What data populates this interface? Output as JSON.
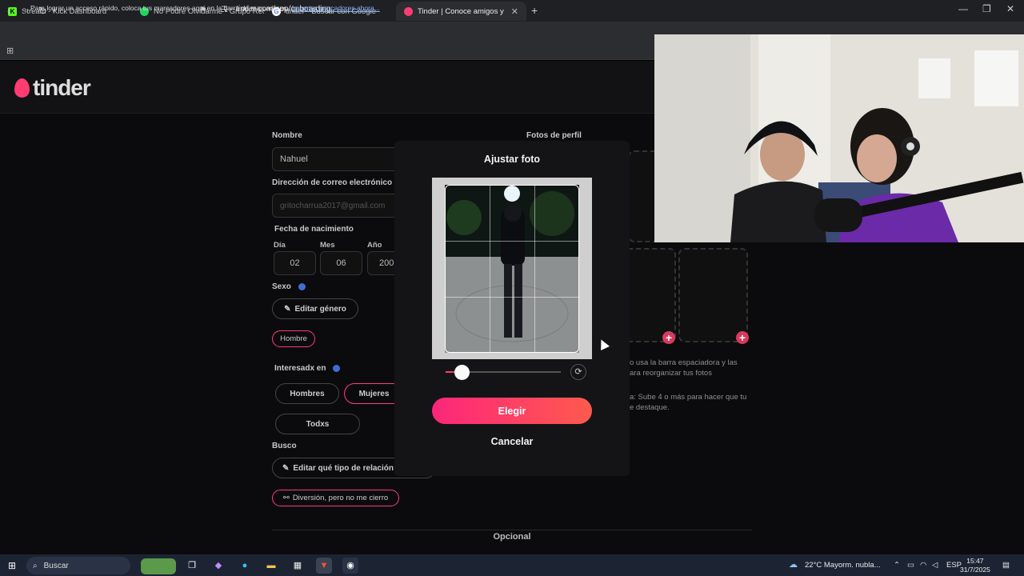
{
  "browser": {
    "tabs": [
      {
        "label": "Stream - Kick Dashboard",
        "icon": "kick-icon",
        "color": "#53fc18"
      },
      {
        "label": "No Podre Olvidarme • Grupo Red",
        "icon": "spotify-icon",
        "color": "#1ed760"
      },
      {
        "label": "tinder - Buscar con Google",
        "icon": "google-icon",
        "color": "#ffffff"
      },
      {
        "label": "Tinder | Conoce amigos y gente",
        "icon": "tinder-icon",
        "color": "#fe3c72"
      }
    ],
    "new_tab": "+",
    "url": "tinder.com/app/onboarding",
    "bookmarks_text": "Para lograr un acceso rápido, coloca tus marcadores aquí en la barra de marcadores.",
    "bookmarks_link": "Importar marcadores ahora..."
  },
  "page": {
    "logo": "tinder",
    "nombre_label": "Nombre",
    "nombre_value": "Nahuel",
    "email_label": "Dirección de correo electrónico",
    "email_value": "gritocharrua2017@gmail.com",
    "fecha_label": "Fecha de nacimiento",
    "dia_label": "Día",
    "dia_value": "02",
    "mes_label": "Mes",
    "mes_value": "06",
    "anio_label": "Año",
    "anio_value": "200",
    "sexo_label": "Sexo",
    "editar_genero": "Editar género",
    "genero_value": "Hombre",
    "interes_label": "Interesadx en",
    "interes_options": [
      "Hombres",
      "Mujeres",
      "Todxs"
    ],
    "busco_label": "Busco",
    "editar_relacion": "Editar qué tipo de relación",
    "relacion_value": "Diversión, pero no me cierro",
    "opcional": "Opcional",
    "fotos_label": "Fotos de perfil",
    "hint1": "o usa la barra espaciadora y las",
    "hint2": "ara reorganizar tus fotos",
    "hint3": "a: Sube 4 o más para hacer que tu",
    "hint4": "e destaque."
  },
  "modal": {
    "title": "Ajustar foto",
    "zoom": 0.14,
    "elegir": "Elegir",
    "cancelar": "Cancelar"
  },
  "taskbar": {
    "search": "Buscar",
    "weather": "22°C  Mayorm. nubla...",
    "lang": "ESP",
    "time": "15:47",
    "date": "31/7/2025"
  }
}
